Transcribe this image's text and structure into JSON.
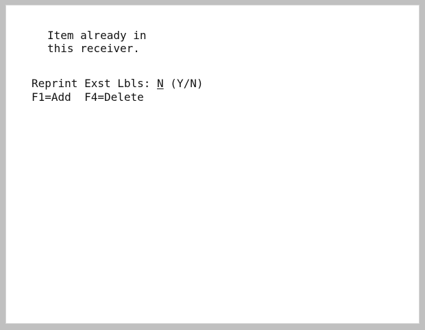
{
  "message": {
    "line1": "Item already in",
    "line2": "this receiver."
  },
  "prompt": {
    "label": "Reprint Exst Lbls: ",
    "value": "N",
    "hint": " (Y/N)"
  },
  "function_keys": {
    "f1": "F1=Add",
    "separator": "  ",
    "f4": "F4=Delete"
  }
}
